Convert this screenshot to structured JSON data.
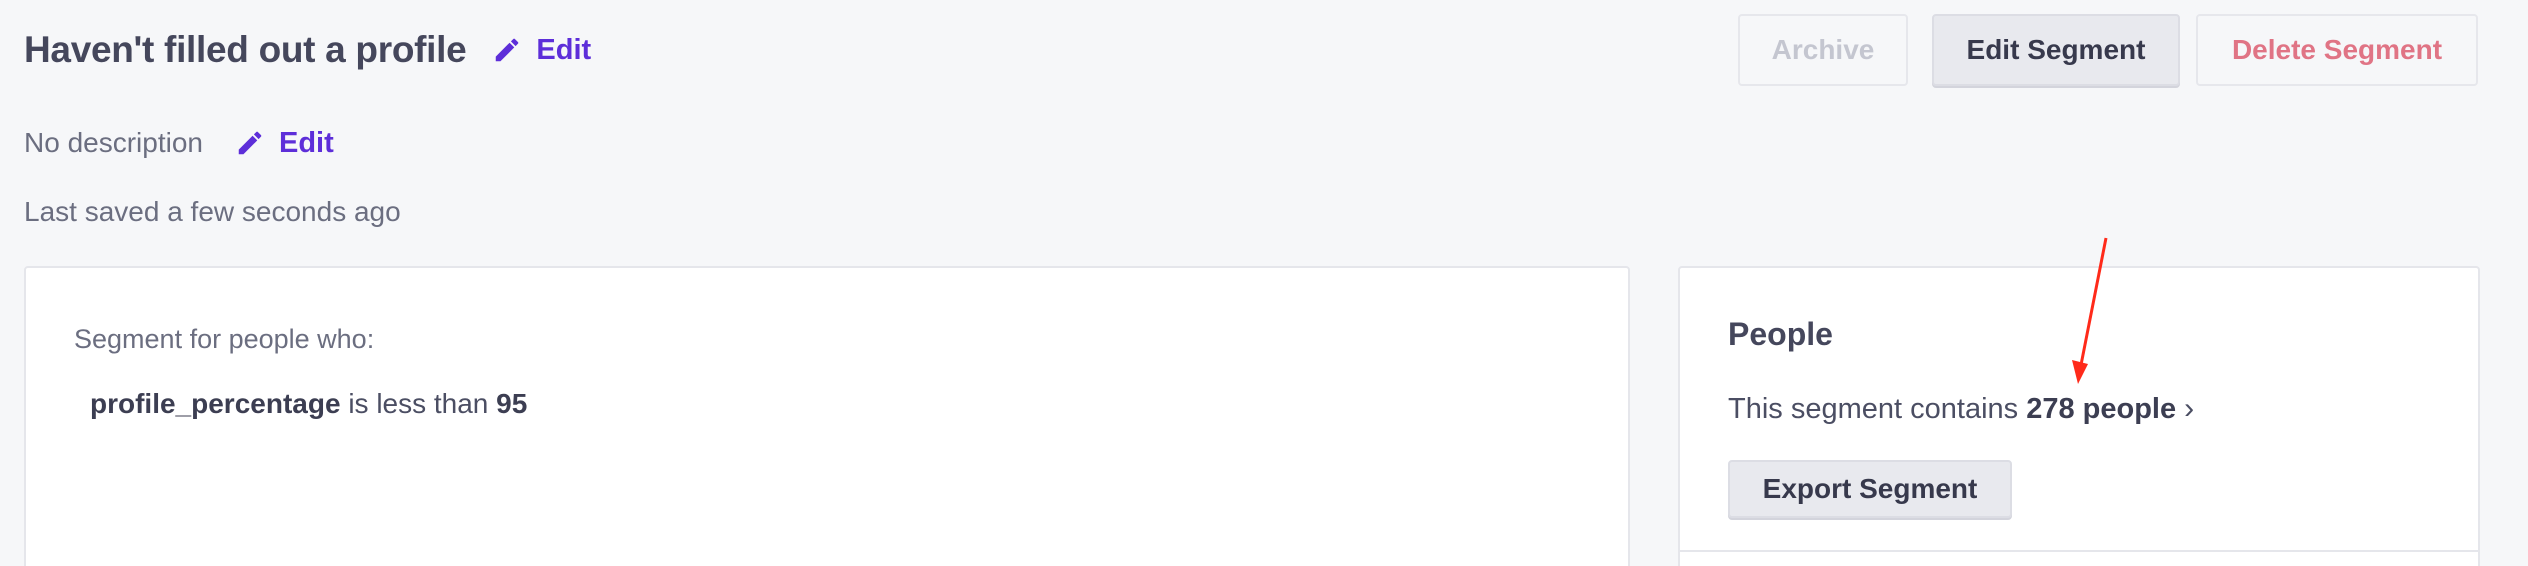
{
  "header": {
    "title": "Haven't filled out a profile",
    "edit_label": "Edit"
  },
  "description": {
    "text": "No description",
    "edit_label": "Edit"
  },
  "saved_status": "Last saved a few seconds ago",
  "toolbar": {
    "archive_label": "Archive",
    "edit_segment_label": "Edit Segment",
    "delete_segment_label": "Delete Segment"
  },
  "segment": {
    "intro": "Segment for people who:",
    "rule": {
      "field": "profile_percentage",
      "operator": "is less than",
      "value": "95"
    }
  },
  "people": {
    "title": "People",
    "prefix": "This segment contains",
    "count_label": "278 people",
    "chevron": "›",
    "export_label": "Export Segment"
  },
  "colors": {
    "accent": "#5d2ed9",
    "danger": "#e07485",
    "annotation_arrow": "#ff2a1a"
  },
  "icons": {
    "edit": "pencil-icon",
    "annotation": "red-arrow-annotation"
  }
}
